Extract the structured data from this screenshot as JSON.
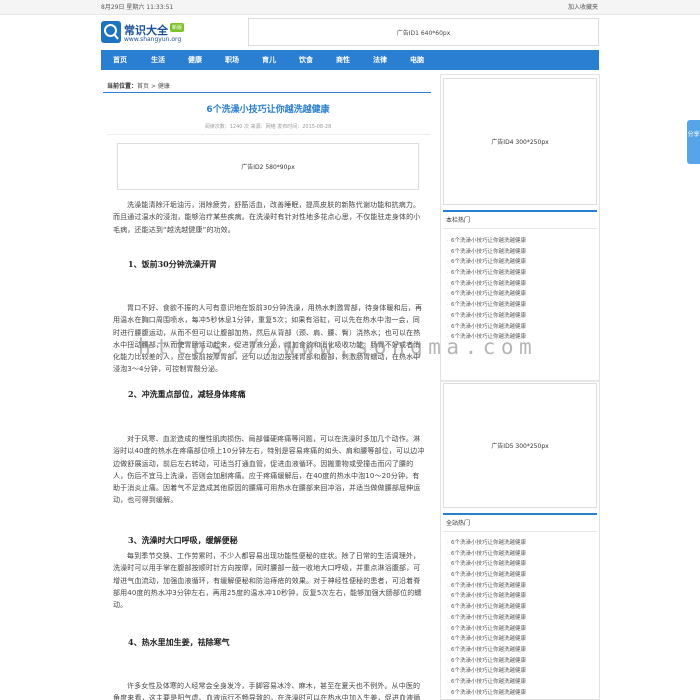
{
  "topbar": {
    "date": "8月29日 星期六 11:33:51",
    "fav_label": "加入收藏夹"
  },
  "logo": {
    "title": "常识大全",
    "badge": "新版",
    "url": "www.shangyun.org"
  },
  "ads": {
    "top": "广告ID1 640*60px",
    "mid": "广告ID2 580*90px",
    "side1": "广告ID4 300*250px",
    "side2": "广告ID5 300*250px"
  },
  "nav": {
    "items": [
      "首页",
      "生活",
      "健康",
      "职场",
      "育儿",
      "饮食",
      "商性",
      "法律",
      "电脑"
    ]
  },
  "breadcrumb": {
    "label": "当前位置：",
    "home": "首页",
    "sep": " > ",
    "current": "健康"
  },
  "article": {
    "title": "6个洗澡小技巧让你越洗越健康",
    "meta": "阅读次数：1240 次   来源：网络   发布时间：2015-08-28",
    "intro": "洗澡能清除汗垢油污，消除疲劳，舒筋活血，改善睡眠，提高皮肤的新陈代谢功能和抗病力。而且通过温水的浸泡，能够治疗某些疾病。在洗澡时有针对性地多花点心思，不仅能驻走身体的小毛病，还能达到“越洗越健康”的功效。",
    "h1": "1、饭前30分钟洗澡开胃",
    "p1": "胃口不好、食欲不振的人可有意识地在饭前30分钟洗澡，用热水刺激胃部，待身体暖和后，再用温水在胸口周围喷水，每冲5秒休息1分钟，重复5次；如果有浴缸，可以先在热水中泡一会，同时进行腰腹运动，从而不但可以让腹部加热，然后从背部（颈、肩、腰、臀）浇热水；也可以在热水中扭动腰部，从而使胃肠活动起来，促进胃液分泌，增加食欲和消化吸收功能。肠胃不好或者消化能力比较差的人，应在饭前按摩胃部，还可以边泡边按揉胃部和腹部，刺激肠胃蠕动，在热水中浸泡3～4分钟，可控制胃酸分泌。",
    "h2": "2、冲洗重点部位，减轻身体疼痛",
    "p2": "对于风寒、血淤造成的慢性肌肉损伤、局部僵硬疼痛等问题，可以在洗澡时多加几个动作。淋浴时以40度的热水在疼痛部位喷上10分钟左右，特别是容易疼痛的如头、肩和腰等部位，可以边冲边做舒展运动，前后左右转动，可适当打通血管，促进血液循环。因搬重物或受撞击而闪了腰的人，伤后不宜马上洗澡，否则会加剧疼痛。应于疼痛缓解后，在40度的热水中泡10～20分钟，有助于消炎止痛。因着气不足造成其他原因的腰痛可用热水在腰部来回冲浴，并适当做做腰部屈伸运动，也可得到缓解。",
    "h3": "3、洗澡时大口呼吸，缓解便秘",
    "p3": "每到季节交换、工作劳累时，不少人都容易出现功能性便秘的症状。除了日常的生活调理外，洗澡时可以用手掌在腹部按顺时针方向按摩，同时腰部一鼓一收地大口呼吸，并重点淋浴腹部，可增进气血流动，加强血液循环，有缓解便秘和防治痔疮的效果。对于神经性便秘的患者，可沿着脊部用40度的热水冲3分钟左右，再用25度的温水冲10秒钟，反复5次左右，能够加强大肠部位的蠕动。",
    "h4": "4、热水里加生姜，祛除寒气",
    "p4": "许多女性及体寒的人经常会全身发冷，手脚容易冰冷、麻木，甚至在夏天也不例外。从中医的角度来看，这主要是阳气虚、血液运行不畅导致的，在洗澡时可以在热水中加入生姜，促进血液循环。"
  },
  "sidebar": {
    "box1": {
      "title": "本栏热门",
      "items": [
        "6个洗澡小技巧让你越洗越健康",
        "6个洗澡小技巧让你越洗越健康",
        "6个洗澡小技巧让你越洗越健康",
        "6个洗澡小技巧让你越洗越健康",
        "6个洗澡小技巧让你越洗越健康",
        "6个洗澡小技巧让你越洗越健康",
        "6个洗澡小技巧让你越洗越健康",
        "6个洗澡小技巧让你越洗越健康",
        "6个洗澡小技巧让你越洗越健康",
        "6个洗澡小技巧让你越洗越健康"
      ]
    },
    "box2": {
      "title": "全站热门",
      "items": [
        "6个洗澡小技巧让你越洗越健康",
        "6个洗澡小技巧让你越洗越健康",
        "6个洗澡小技巧让你越洗越健康",
        "6个洗澡小技巧让你越洗越健康",
        "6个洗澡小技巧让你越洗越健康",
        "6个洗澡小技巧让你越洗越健康",
        "6个洗澡小技巧让你越洗越健康",
        "6个洗澡小技巧让你越洗越健康",
        "6个洗澡小技巧让你越洗越健康",
        "6个洗澡小技巧让你越洗越健康",
        "6个洗澡小技巧让你越洗越健康",
        "6个洗澡小技巧让你越洗越健康",
        "6个洗澡小技巧让你越洗越健康",
        "6个洗澡小技巧让你越洗越健康",
        "6个洗澡小技巧让你越洗越健康"
      ]
    }
  },
  "share": {
    "label": "分享"
  },
  "watermark": "https://www.songma.com",
  "colors": {
    "accent": "#2b7fd3",
    "title": "#2b7fd3",
    "badge": "#7cc22b"
  }
}
